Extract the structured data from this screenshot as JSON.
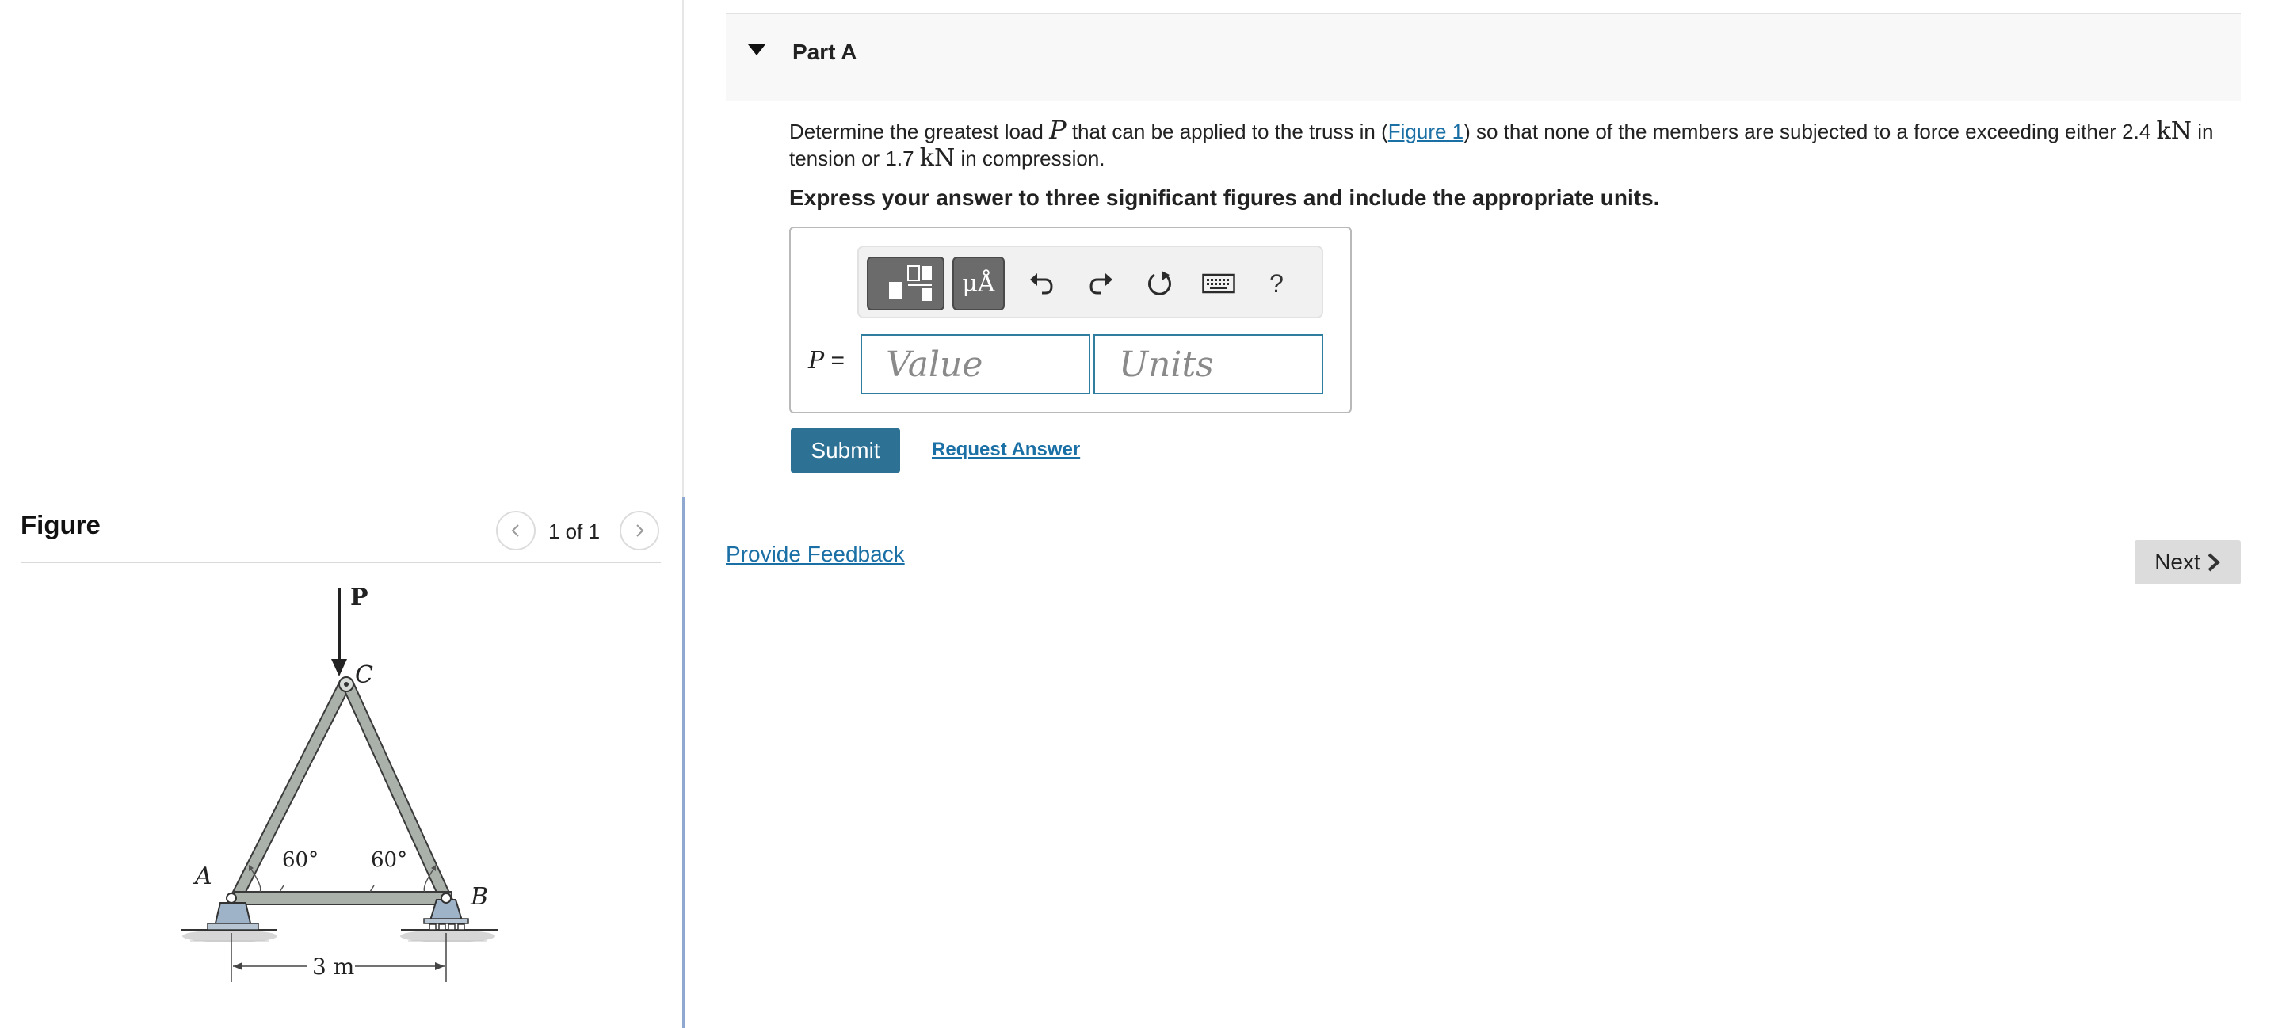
{
  "figure_panel": {
    "title": "Figure",
    "counter": "1 of 1",
    "diagram_labels": {
      "load": "P",
      "joint_top": "C",
      "joint_left": "A",
      "joint_right": "B",
      "angle_left": "60°",
      "angle_right": "60°",
      "span": "3 m"
    }
  },
  "part": {
    "title": "Part A",
    "problem": {
      "t1": "Determine the greatest load ",
      "var": "P",
      "t2": " that can be applied to the truss in (",
      "figure_link": "Figure 1",
      "t3": ") so that none of the members are subjected to a force exceeding either 2.4 ",
      "unit1": "kN",
      "t4": " in tension or 1.7 ",
      "unit2": "kN",
      "t5": " in compression."
    },
    "instruction": "Express your answer to three significant figures and include the appropriate units."
  },
  "answer": {
    "label_var": "P",
    "label_eq": " =",
    "value_placeholder": "Value",
    "units_placeholder": "Units",
    "toolbar": {
      "units_symbol": "μÅ",
      "help": "?",
      "icons": [
        "templates-icon",
        "units-icon",
        "undo-icon",
        "redo-icon",
        "reset-icon",
        "keyboard-icon",
        "help-icon"
      ]
    }
  },
  "buttons": {
    "submit": "Submit",
    "request_answer": "Request Answer",
    "provide_feedback": "Provide Feedback",
    "next": "Next"
  },
  "colors": {
    "primary": "#2d7194",
    "link": "#1a6fa5",
    "input_border": "#2f7ea0"
  }
}
